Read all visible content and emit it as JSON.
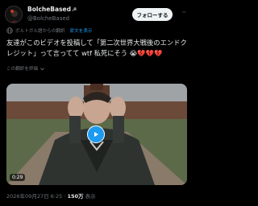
{
  "user": {
    "display_name": "BolcheBased",
    "flag": "☭",
    "handle": "@BolcheBased"
  },
  "header": {
    "follow_label": "フォローする",
    "more_label": "···"
  },
  "translation": {
    "source_text": "ポルトガル語からの翻訳",
    "link_text": "原文を表示"
  },
  "tweet": {
    "text": "友達がこのビデオを投稿して「第二次世界大戦後のエンドクレジット」って言ってて wtf 私死にそう 😭💔💔💔"
  },
  "rating": {
    "label": "この翻訳を評価"
  },
  "media": {
    "duration": "0:29"
  },
  "meta": {
    "timestamp": "2026年09月27日 6:25",
    "separator": "·",
    "views_count": "150万",
    "views_label": "表示"
  },
  "colors": {
    "background": "#000000",
    "text": "#e7e9ea",
    "muted": "#71767b",
    "accent": "#1d9bf0",
    "follow_bg": "#eff3f4"
  }
}
